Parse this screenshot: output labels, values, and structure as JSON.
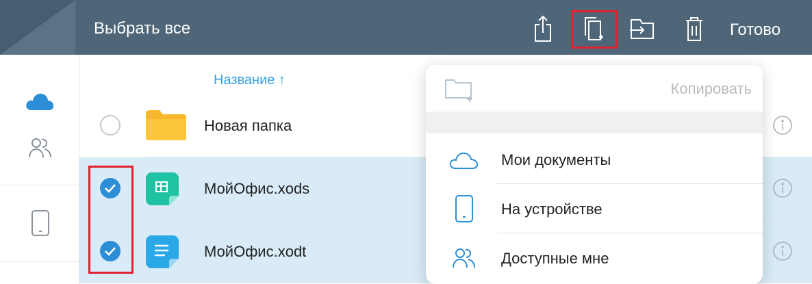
{
  "toolbar": {
    "select_all_label": "Выбрать все",
    "done_label": "Готово",
    "icons": [
      "share-icon",
      "copy-icon",
      "move-icon",
      "trash-icon"
    ],
    "highlight_color": "#e0212e"
  },
  "sidebar": {
    "items": [
      {
        "icon": "cloud-icon",
        "active": true
      },
      {
        "icon": "shared-users-icon",
        "active": false
      },
      {
        "icon": "tablet-device-icon",
        "active": false
      }
    ]
  },
  "list": {
    "sort_header": "Название ↑",
    "rows": [
      {
        "name": "Новая папка",
        "type": "folder",
        "selected": false
      },
      {
        "name": "МойОфис.xods",
        "type": "spreadsheet",
        "selected": true
      },
      {
        "name": "МойОфис.xodt",
        "type": "text-document",
        "selected": true
      }
    ]
  },
  "copy_popover": {
    "title": "Копировать",
    "destinations": [
      {
        "label": "Мои документы",
        "icon": "cloud-outline-icon"
      },
      {
        "label": "На устройстве",
        "icon": "tablet-outline-icon"
      },
      {
        "label": "Доступные мне",
        "icon": "shared-users-icon"
      }
    ]
  },
  "colors": {
    "topbar": "#4e6678",
    "accent": "#2b8ed6",
    "selected_row": "#d8ebf6"
  }
}
